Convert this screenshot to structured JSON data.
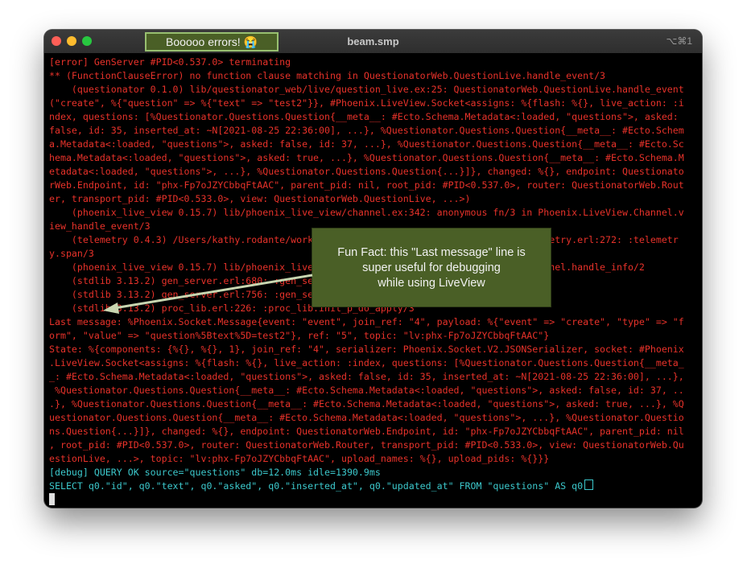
{
  "window": {
    "title": "beam.smp",
    "shortcut": "⌥⌘1",
    "banner": "Booooo errors! 😭"
  },
  "callout": {
    "line1": "Fun Fact: this \"Last message\" line is",
    "line2": "super useful for debugging",
    "line3": "while using LiveView"
  },
  "terminal": {
    "lines": [
      "[error] GenServer #PID<0.537.0> terminating",
      "** (FunctionClauseError) no function clause matching in QuestionatorWeb.QuestionLive.handle_event/3",
      "    (questionator 0.1.0) lib/questionator_web/live/question_live.ex:25: QuestionatorWeb.QuestionLive.handle_event",
      "(\"create\", %{\"question\" => %{\"text\" => \"test2\"}}, #Phoenix.LiveView.Socket<assigns: %{flash: %{}, live_action: :i",
      "ndex, questions: [%Questionator.Questions.Question{__meta__: #Ecto.Schema.Metadata<:loaded, \"questions\">, asked:",
      "false, id: 35, inserted_at: ~N[2021-08-25 22:36:00], ...}, %Questionator.Questions.Question{__meta__: #Ecto.Schem",
      "a.Metadata<:loaded, \"questions\">, asked: false, id: 37, ...}, %Questionator.Questions.Question{__meta__: #Ecto.Sc",
      "hema.Metadata<:loaded, \"questions\">, asked: true, ...}, %Questionator.Questions.Question{__meta__: #Ecto.Schema.M",
      "etadata<:loaded, \"questions\">, ...}, %Questionator.Questions.Question{...}]}, changed: %{}, endpoint: Questionato",
      "rWeb.Endpoint, id: \"phx-Fp7oJZYCbbqFtAAC\", parent_pid: nil, root_pid: #PID<0.537.0>, router: QuestionatorWeb.Rout",
      "er, transport_pid: #PID<0.533.0>, view: QuestionatorWeb.QuestionLive, ...>)",
      "    (phoenix_live_view 0.15.7) lib/phoenix_live_view/channel.ex:342: anonymous fn/3 in Phoenix.LiveView.Channel.v",
      "iew_handle_event/3",
      "    (telemetry 0.4.3) /Users/kathy.rodante/work                                         metry.erl:272: :telemetr",
      "y.span/3",
      "    (phoenix_live_view 0.15.7) lib/phoenix_live                                         nnel.handle_info/2",
      "    (stdlib 3.13.2) gen_server.erl:680: :gen_se",
      "    (stdlib 3.13.2) gen_server.erl:756: :gen_se",
      "    (stdlib 3.13.2) proc_lib.erl:226: :proc_lib.init_p_do_apply/3",
      "Last message: %Phoenix.Socket.Message{event: \"event\", join_ref: \"4\", payload: %{\"event\" => \"create\", \"type\" => \"f",
      "orm\", \"value\" => \"question%5Btext%5D=test2\"}, ref: \"5\", topic: \"lv:phx-Fp7oJZYCbbqFtAAC\"}",
      "State: %{components: {%{}, %{}, 1}, join_ref: \"4\", serializer: Phoenix.Socket.V2.JSONSerializer, socket: #Phoenix",
      ".LiveView.Socket<assigns: %{flash: %{}, live_action: :index, questions: [%Questionator.Questions.Question{__meta_",
      "_: #Ecto.Schema.Metadata<:loaded, \"questions\">, asked: false, id: 35, inserted_at: ~N[2021-08-25 22:36:00], ...},",
      " %Questionator.Questions.Question{__meta__: #Ecto.Schema.Metadata<:loaded, \"questions\">, asked: false, id: 37, ..",
      ".}, %Questionator.Questions.Question{__meta__: #Ecto.Schema.Metadata<:loaded, \"questions\">, asked: true, ...}, %Q",
      "uestionator.Questions.Question{__meta__: #Ecto.Schema.Metadata<:loaded, \"questions\">, ...}, %Questionator.Questio",
      "ns.Question{...}]}, changed: %{}, endpoint: QuestionatorWeb.Endpoint, id: \"phx-Fp7oJZYCbbqFtAAC\", parent_pid: nil",
      ", root_pid: #PID<0.537.0>, router: QuestionatorWeb.Router, transport_pid: #PID<0.533.0>, view: QuestionatorWeb.Qu",
      "estionLive, ...>, topic: \"lv:phx-Fp7oJZYCbbqFtAAC\", upload_names: %{}, upload_pids: %{}}}",
      "[debug] QUERY OK source=\"questions\" db=12.0ms idle=1390.9ms",
      "SELECT q0.\"id\", q0.\"text\", q0.\"asked\", q0.\"inserted_at\", q0.\"updated_at\" FROM \"questions\" AS q0"
    ]
  },
  "colors": {
    "error_text": "#e8322a",
    "debug_text": "#3cc8cc",
    "callout_bg": "#4a5f26"
  }
}
